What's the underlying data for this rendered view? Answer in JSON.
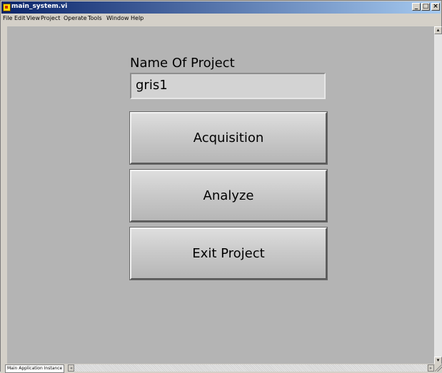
{
  "window": {
    "title": "main_system.vi",
    "min_glyph": "_",
    "max_glyph": "□",
    "close_glyph": "×"
  },
  "menu": {
    "items": [
      {
        "label": "File"
      },
      {
        "label": "Edit"
      },
      {
        "label": "View"
      },
      {
        "label": "Project"
      },
      {
        "label": "Operate"
      },
      {
        "label": "Tools"
      },
      {
        "label": "Window"
      },
      {
        "label": "Help"
      }
    ]
  },
  "panel": {
    "name_label": "Name Of Project",
    "name_value": "gris1",
    "buttons": {
      "acquisition": "Acquisition",
      "analyze": "Analyze",
      "exit": "Exit Project"
    }
  },
  "status": {
    "instance": "Main Application Instance",
    "left_arrow": "◂",
    "right_arrow": "▸"
  },
  "scroll": {
    "up": "▴",
    "down": "▾"
  },
  "colors": {
    "title_gradient_start": "#0a246a",
    "title_gradient_end": "#a6caf0",
    "panel_background": "#b4b4b4",
    "window_chrome": "#d4d0c8"
  }
}
